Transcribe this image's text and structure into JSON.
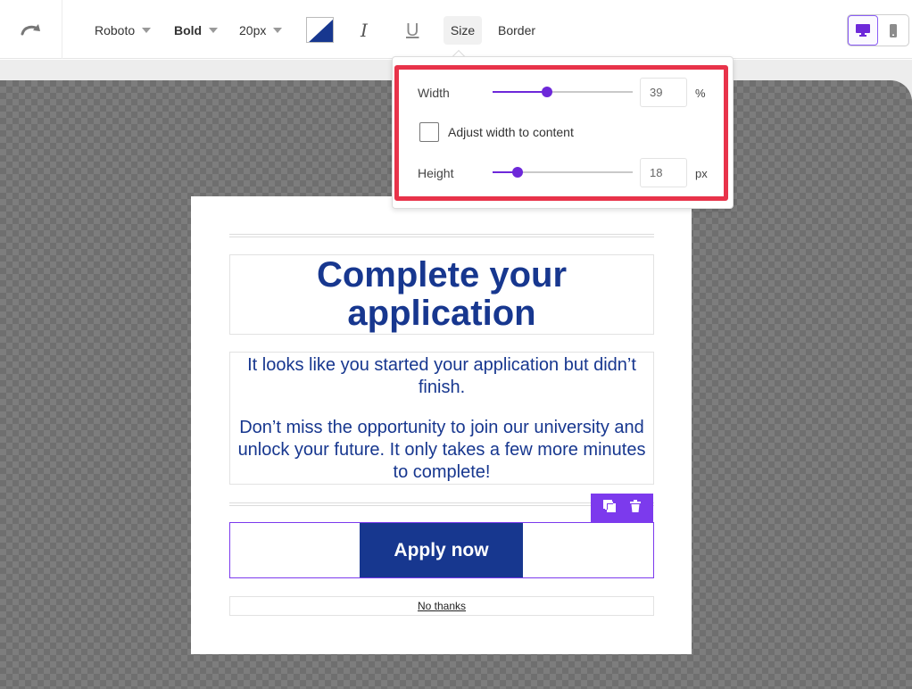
{
  "toolbar": {
    "font_family": "Roboto",
    "font_weight": "Bold",
    "font_size": "20px",
    "size_tab": "Size",
    "border_tab": "Border",
    "text_color": "#17378f",
    "active_view": "desktop"
  },
  "size_panel": {
    "width_label": "Width",
    "width_value": "39",
    "width_unit": "%",
    "adjust_label": "Adjust width to content",
    "adjust_checked": false,
    "height_label": "Height",
    "height_value": "18",
    "height_unit": "px"
  },
  "email": {
    "headline": "Complete your application",
    "paragraph1": "It looks like you started your application but didn’t finish.",
    "paragraph2": "Don’t miss the opportunity to join our university and unlock your future. It only takes a few more minutes to complete!",
    "button_label": "Apply now",
    "decline_link": "No thanks"
  },
  "colors": {
    "brand_blue": "#17378f",
    "accent_purple": "#7c3aed",
    "highlight_red": "#e8334a"
  }
}
